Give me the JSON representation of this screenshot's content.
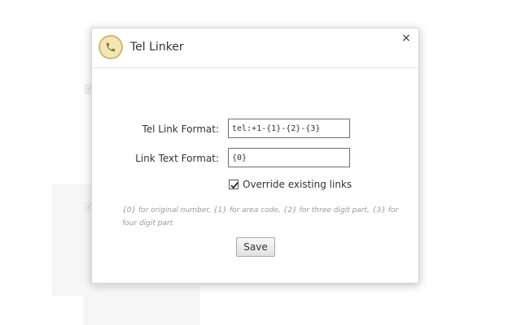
{
  "dialog": {
    "title": "Tel Linker",
    "app_icon": "phone-icon",
    "close_label": "×"
  },
  "form": {
    "tel_link_format_label": "Tel Link Format:",
    "tel_link_format_value": "tel:+1-{1}-{2}-{3}",
    "link_text_format_label": "Link Text Format:",
    "link_text_format_value": "{0}",
    "override_label": "Override existing links",
    "override_checked": true,
    "hint": "{0} for original number, {1} for area code, {2} for three digit part, {3} for four digit part",
    "save_label": "Save"
  },
  "colors": {
    "icon_fill": "#f2e6b4",
    "icon_border": "#cbb97a",
    "text": "#333333",
    "hint_text": "#9a9a9a"
  }
}
